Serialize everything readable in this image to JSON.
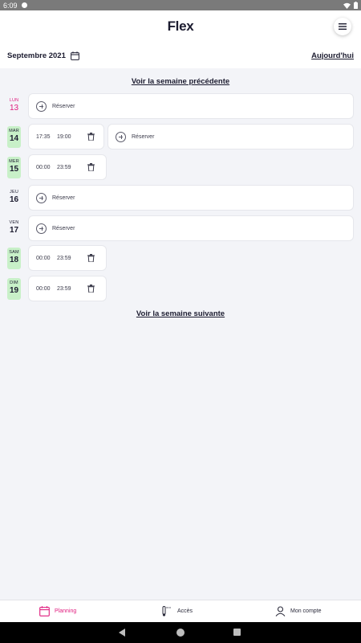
{
  "status": {
    "time": "6:09"
  },
  "app": {
    "brand": "Flex"
  },
  "header": {
    "month": "Septembre 2021",
    "today": "Aujourd'hui"
  },
  "links": {
    "previous_week": "Voir la semaine précédente",
    "next_week": "Voir la semaine suivante"
  },
  "days": [
    {
      "name": "LUN",
      "num": "13",
      "highlight": "today",
      "reserve": "Réserver",
      "slots": []
    },
    {
      "name": "MAR",
      "num": "14",
      "highlight": "booked",
      "reserve": "Réserver",
      "slots": [
        {
          "start": "17:35",
          "end": "19:00"
        }
      ]
    },
    {
      "name": "MER",
      "num": "15",
      "highlight": "booked",
      "reserve": "",
      "slots": [
        {
          "start": "00:00",
          "end": "23:59"
        }
      ]
    },
    {
      "name": "JEU",
      "num": "16",
      "highlight": "none",
      "reserve": "Réserver",
      "slots": []
    },
    {
      "name": "VEN",
      "num": "17",
      "highlight": "none",
      "reserve": "Réserver",
      "slots": []
    },
    {
      "name": "SAM",
      "num": "18",
      "highlight": "booked",
      "reserve": "",
      "slots": [
        {
          "start": "00:00",
          "end": "23:59"
        }
      ]
    },
    {
      "name": "DIM",
      "num": "19",
      "highlight": "booked",
      "reserve": "",
      "slots": [
        {
          "start": "00:00",
          "end": "23:59"
        }
      ]
    }
  ],
  "bottom_nav": {
    "planning": "Planning",
    "access": "Accès",
    "account": "Mon compte"
  },
  "colors": {
    "accent": "#e01c7e",
    "booked": "#c8f0c8",
    "background": "#f3f4f8"
  },
  "icons": {
    "menu": "hamburger-icon",
    "calendar": "calendar-icon",
    "add": "plus-circle-icon",
    "delete": "trash-icon",
    "access": "thermometer-icon",
    "account": "person-icon"
  }
}
